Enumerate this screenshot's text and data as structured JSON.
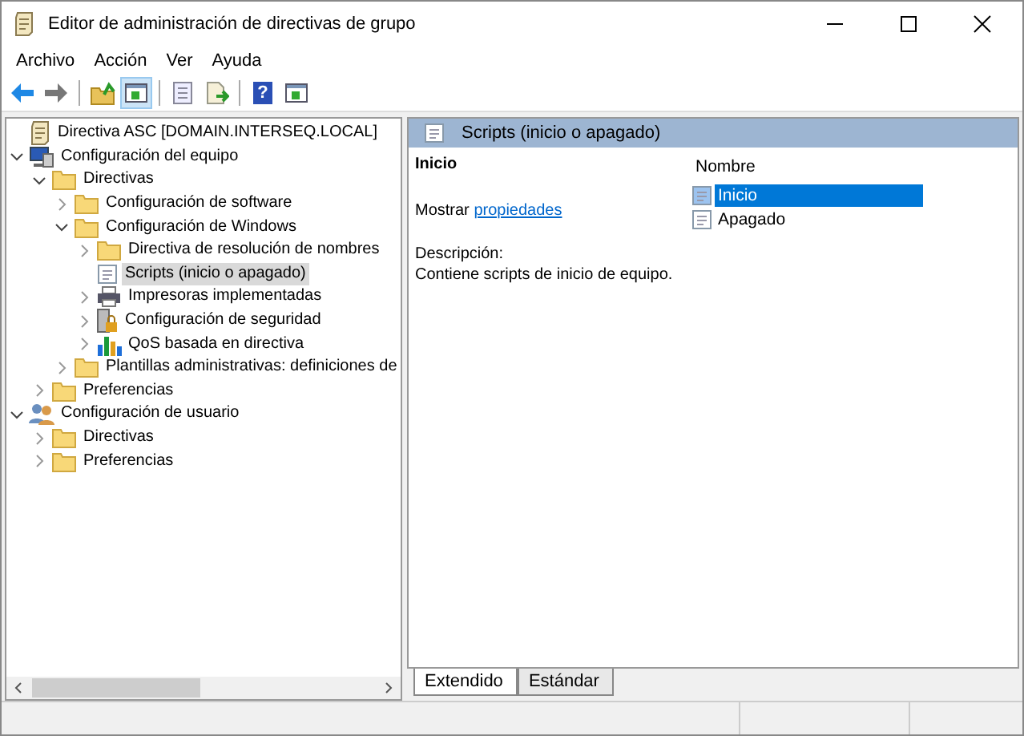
{
  "window": {
    "title": "Editor de administración de directivas de grupo"
  },
  "menu": [
    {
      "label": "Archivo"
    },
    {
      "label": "Acción"
    },
    {
      "label": "Ver"
    },
    {
      "label": "Ayuda"
    }
  ],
  "toolbar": [
    {
      "kind": "back"
    },
    {
      "kind": "forward"
    },
    {
      "kind": "sep"
    },
    {
      "kind": "up"
    },
    {
      "kind": "pane",
      "selected": true
    },
    {
      "kind": "sep"
    },
    {
      "kind": "props"
    },
    {
      "kind": "export"
    },
    {
      "kind": "sep"
    },
    {
      "kind": "help",
      "label": "?"
    },
    {
      "kind": "pane2"
    }
  ],
  "tree": [
    {
      "label": "Directiva ASC [DOMAIN.INTERSEQ.LOCAL]",
      "kind": "policy",
      "selected": false,
      "children": [
        {
          "label": "Configuración del equipo",
          "kind": "computer",
          "expanded": true,
          "selected": false,
          "children": [
            {
              "label": "Directivas",
              "kind": "folder",
              "expanded": true,
              "selected": false,
              "children": [
                {
                  "label": "Configuración de software",
                  "kind": "folder",
                  "expanded": false,
                  "selected": false
                },
                {
                  "label": "Configuración de Windows",
                  "kind": "folder",
                  "expanded": true,
                  "selected": false,
                  "children": [
                    {
                      "label": "Directiva de resolución de nombres",
                      "kind": "folder",
                      "expanded": false,
                      "selected": false
                    },
                    {
                      "label": "Scripts (inicio o apagado)",
                      "kind": "script",
                      "selected": true
                    },
                    {
                      "label": "Impresoras implementadas",
                      "kind": "printer",
                      "expanded": false,
                      "selected": false
                    },
                    {
                      "label": "Configuración de seguridad",
                      "kind": "security",
                      "expanded": false,
                      "selected": false
                    },
                    {
                      "label": "QoS basada en directiva",
                      "kind": "chart",
                      "expanded": false,
                      "selected": false
                    }
                  ]
                },
                {
                  "label": "Plantillas administrativas: definiciones de",
                  "kind": "folder",
                  "expanded": false,
                  "selected": false
                }
              ]
            },
            {
              "label": "Preferencias",
              "kind": "folder",
              "expanded": false,
              "selected": false
            }
          ]
        },
        {
          "label": "Configuración de usuario",
          "kind": "user",
          "expanded": true,
          "selected": false,
          "children": [
            {
              "label": "Directivas",
              "kind": "folder",
              "expanded": false,
              "selected": false
            },
            {
              "label": "Preferencias",
              "kind": "folder",
              "expanded": false,
              "selected": false
            }
          ]
        }
      ]
    }
  ],
  "detail": {
    "header": "Scripts (inicio o apagado)",
    "item_title": "Inicio",
    "show_prefix": "Mostrar",
    "show_link": "propiedades",
    "description_label": "Descripción:",
    "description": "Contiene scripts de inicio de equipo."
  },
  "list": {
    "column": "Nombre",
    "items": [
      {
        "label": "Inicio",
        "selected": true
      },
      {
        "label": "Apagado",
        "selected": false
      }
    ]
  },
  "view_tabs": [
    {
      "label": "Extendido",
      "selected": true
    },
    {
      "label": "Estándar",
      "selected": false
    }
  ]
}
